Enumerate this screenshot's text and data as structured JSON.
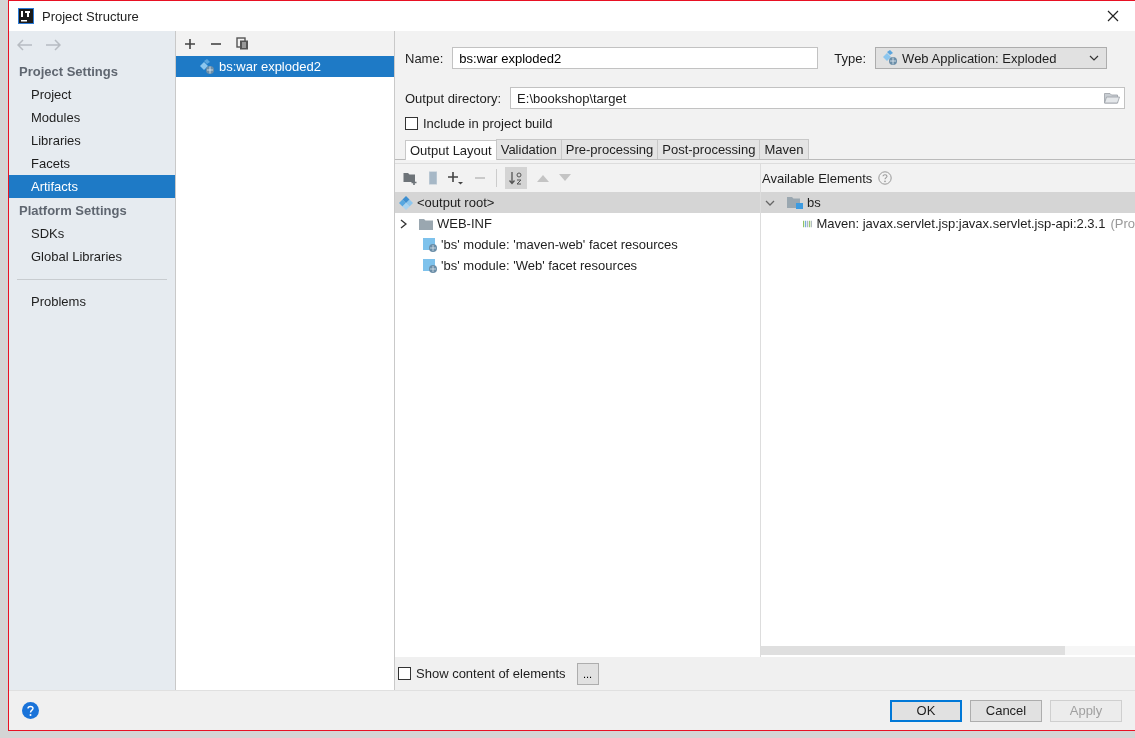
{
  "window": {
    "title": "Project Structure"
  },
  "sidebar": {
    "sections": [
      {
        "heading": "Project Settings",
        "items": [
          {
            "label": "Project",
            "selected": false
          },
          {
            "label": "Modules",
            "selected": false
          },
          {
            "label": "Libraries",
            "selected": false
          },
          {
            "label": "Facets",
            "selected": false
          },
          {
            "label": "Artifacts",
            "selected": true
          }
        ]
      },
      {
        "heading": "Platform Settings",
        "items": [
          {
            "label": "SDKs",
            "selected": false
          },
          {
            "label": "Global Libraries",
            "selected": false
          }
        ]
      }
    ],
    "footer_items": [
      {
        "label": "Problems",
        "selected": false
      }
    ]
  },
  "artifacts": [
    {
      "label": "bs:war exploded2",
      "selected": true
    }
  ],
  "form": {
    "name_label": "Name:",
    "name_value": "bs:war exploded2",
    "type_label": "Type:",
    "type_value": "Web Application: Exploded",
    "output_label": "Output directory:",
    "output_value": "E:\\bookshop\\target",
    "include": {
      "label": "Include in project build",
      "checked": false
    }
  },
  "tabs": [
    {
      "label": "Output Layout",
      "selected": true
    },
    {
      "label": "Validation",
      "selected": false
    },
    {
      "label": "Pre-processing",
      "selected": false
    },
    {
      "label": "Post-processing",
      "selected": false
    },
    {
      "label": "Maven",
      "selected": false
    }
  ],
  "output_layout": {
    "root": {
      "label": "<output root>",
      "selected": true
    },
    "items": [
      {
        "label": "WEB-INF",
        "kind": "folder",
        "expanded": false
      },
      {
        "label": "'bs' module: 'maven-web' facet resources",
        "kind": "resource"
      },
      {
        "label": "'bs' module: 'Web' facet resources",
        "kind": "resource"
      }
    ]
  },
  "available": {
    "heading": "Available Elements",
    "items": [
      {
        "label": "bs",
        "kind": "module",
        "expanded": true,
        "selected": true,
        "children": [
          {
            "label": "Maven: javax.servlet.jsp:javax.servlet.jsp-api:2.3.1",
            "suffix": "(Pro",
            "kind": "library"
          }
        ]
      }
    ]
  },
  "show_content": {
    "label": "Show content of elements",
    "checked": false
  },
  "more_button": "...",
  "buttons": [
    {
      "label": "OK",
      "default": true,
      "disabled": false
    },
    {
      "label": "Cancel",
      "default": false,
      "disabled": false
    },
    {
      "label": "Apply",
      "default": false,
      "disabled": true
    }
  ]
}
